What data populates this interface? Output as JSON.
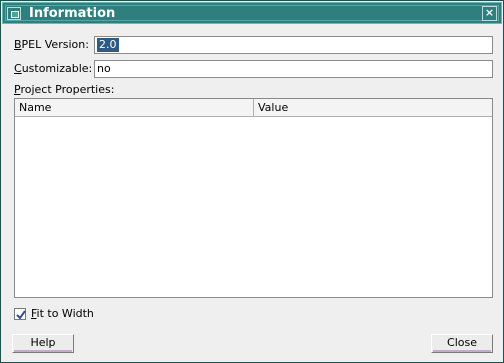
{
  "window": {
    "title": "Information",
    "close_glyph": "×",
    "titlebar_color": "#2f7f7f"
  },
  "form": {
    "bpel_version": {
      "label_mnemonic": "B",
      "label_rest": "PEL Version:",
      "value": "2.0"
    },
    "customizable": {
      "label_mnemonic": "C",
      "label_rest": "ustomizable:",
      "value": "no"
    },
    "project_properties": {
      "label_mnemonic": "P",
      "label_rest": "roject Properties:",
      "columns": [
        "Name",
        "Value"
      ],
      "rows": []
    }
  },
  "fit_to_width": {
    "checked": true,
    "label_mnemonic": "F",
    "label_rest": "it to Width"
  },
  "buttons": {
    "help": "Help",
    "close": "Close"
  },
  "colors": {
    "selection": "#2f5a82",
    "button_accent": "#c8a8d0"
  }
}
